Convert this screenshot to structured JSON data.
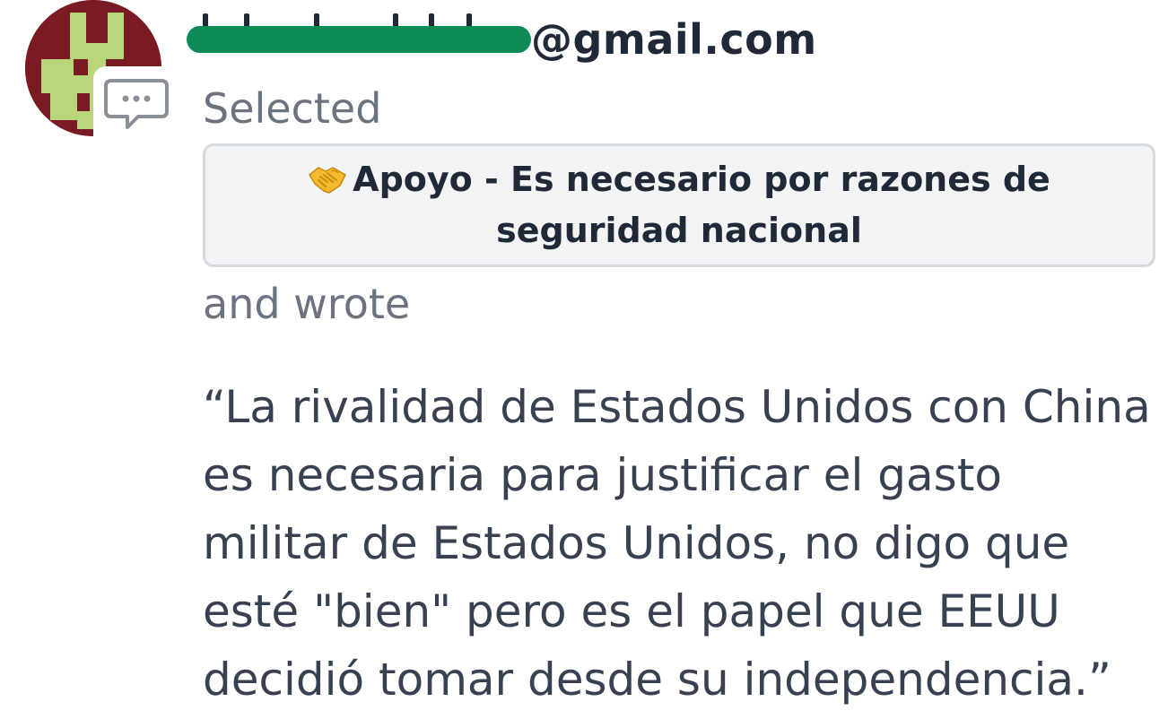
{
  "user": {
    "email_domain": "@gmail.com",
    "email_local_redacted": true
  },
  "response": {
    "selected_label": "Selected",
    "choice_icon": "handshake-icon",
    "choice_label": "Apoyo - Es necesario por razones de seguridad nacional",
    "wrote_label": "and wrote",
    "quote": "“La rivalidad de Estados Unidos con China es necesaria para justificar el gasto militar de Estados Unidos, no digo que esté \"bien\" pero es el papel que EEUU decidió tomar desde su independencia.”"
  },
  "colors": {
    "avatar_bg": "#7a1a22",
    "avatar_fg": "#b9d67a",
    "redaction": "#0b8a56",
    "choice_bg": "#f3f4f6",
    "choice_border": "#d6d9de"
  }
}
